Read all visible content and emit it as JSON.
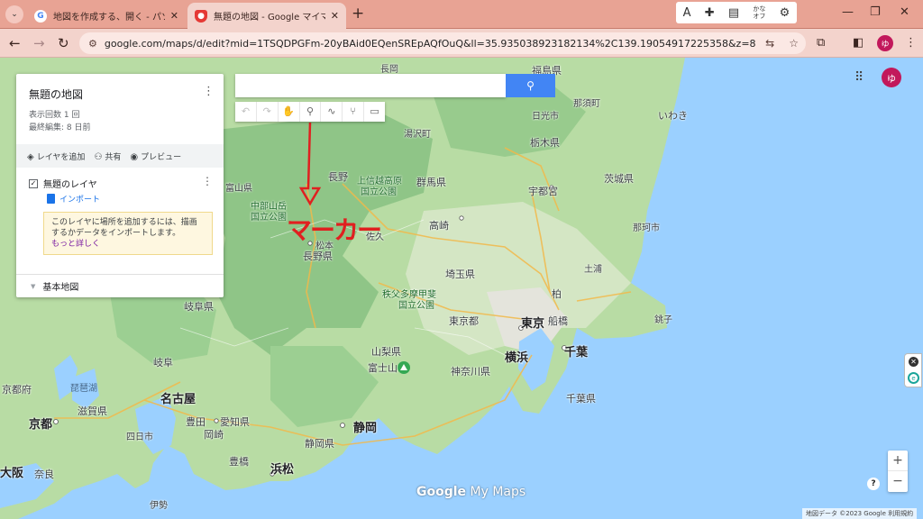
{
  "browser": {
    "tabs": [
      {
        "title": "地図を作成する、開く - パソコン - ",
        "favicon": "G"
      },
      {
        "title": "無題の地図 - Google マイマップ",
        "favicon": "pin"
      }
    ],
    "url": "google.com/maps/d/edit?mid=1TSQDPGFm-20yBAid0EQenSREpAQfOuQ&ll=35.935038923182134%2C139.19054917225358&z=8",
    "profile_initial": "ゆ",
    "extension_labels": {
      "font": "A",
      "kana_top": "かな",
      "kana_bottom": "オフ"
    }
  },
  "panel": {
    "title": "無題の地図",
    "views": "表示回数 1 回",
    "last_edit": "最終編集: 8 日前",
    "actions": {
      "add_layer": "レイヤを追加",
      "share": "共有",
      "preview": "プレビュー"
    },
    "layer_name": "無題のレイヤ",
    "import_label": "インポート",
    "hint_text": "このレイヤに場所を追加するには、描画するかデータをインポートします。",
    "hint_more": "もっと詳しく",
    "basemap_label": "基本地図"
  },
  "map": {
    "avatar_initial": "ゆ",
    "annotation": "マーカー",
    "logo_google": "Google",
    "logo_mymaps": "My Maps",
    "attribution": "地図データ ©2023 Google",
    "terms": "利用規約",
    "labels": [
      {
        "text": "福島県",
        "cls": "mid"
      },
      {
        "text": "いわき",
        "cls": "mid"
      },
      {
        "text": "那須町",
        "cls": ""
      },
      {
        "text": "日光市",
        "cls": ""
      },
      {
        "text": "湯沢町",
        "cls": ""
      },
      {
        "text": "栃木県",
        "cls": "mid"
      },
      {
        "text": "茨城県",
        "cls": "mid"
      },
      {
        "text": "長野",
        "cls": "mid"
      },
      {
        "text": "上信越高原",
        "cls": "green"
      },
      {
        "text": "国立公園",
        "cls": "green"
      },
      {
        "text": "群馬県",
        "cls": "mid"
      },
      {
        "text": "宇都宮",
        "cls": "mid"
      },
      {
        "text": "中部山岳",
        "cls": "green"
      },
      {
        "text": "国立公園",
        "cls": "green"
      },
      {
        "text": "高崎",
        "cls": "mid"
      },
      {
        "text": "佐久",
        "cls": ""
      },
      {
        "text": "松本",
        "cls": ""
      },
      {
        "text": "長野県",
        "cls": "mid"
      },
      {
        "text": "埼玉県",
        "cls": "mid"
      },
      {
        "text": "柏",
        "cls": "mid"
      },
      {
        "text": "秩父多摩甲斐",
        "cls": "green"
      },
      {
        "text": "国立公園",
        "cls": "green"
      },
      {
        "text": "東京都",
        "cls": "mid"
      },
      {
        "text": "東京",
        "cls": "big"
      },
      {
        "text": "船橋",
        "cls": "mid"
      },
      {
        "text": "千葉",
        "cls": "big"
      },
      {
        "text": "山梨県",
        "cls": "mid"
      },
      {
        "text": "横浜",
        "cls": "big"
      },
      {
        "text": "富士山",
        "cls": "mid"
      },
      {
        "text": "神奈川県",
        "cls": "mid"
      },
      {
        "text": "千葉県",
        "cls": "mid"
      },
      {
        "text": "岐阜県",
        "cls": "mid"
      },
      {
        "text": "岐阜",
        "cls": "mid"
      },
      {
        "text": "名古屋",
        "cls": "big"
      },
      {
        "text": "京都府",
        "cls": "mid"
      },
      {
        "text": "滋賀県",
        "cls": "mid"
      },
      {
        "text": "京都",
        "cls": "big"
      },
      {
        "text": "豊田",
        "cls": "mid"
      },
      {
        "text": "愛知県",
        "cls": "mid"
      },
      {
        "text": "岡崎",
        "cls": "mid"
      },
      {
        "text": "静岡",
        "cls": "big"
      },
      {
        "text": "静岡県",
        "cls": "mid"
      },
      {
        "text": "豊橋",
        "cls": "mid"
      },
      {
        "text": "浜松",
        "cls": "big"
      },
      {
        "text": "大阪",
        "cls": "big"
      },
      {
        "text": "奈良",
        "cls": "mid"
      },
      {
        "text": "伊勢",
        "cls": ""
      },
      {
        "text": "四日市",
        "cls": ""
      },
      {
        "text": "銚子",
        "cls": ""
      },
      {
        "text": "那珂市",
        "cls": ""
      },
      {
        "text": "土浦",
        "cls": ""
      },
      {
        "text": "琵琶湖",
        "cls": "sea"
      },
      {
        "text": "長岡",
        "cls": ""
      },
      {
        "text": "富山県",
        "cls": ""
      }
    ]
  }
}
